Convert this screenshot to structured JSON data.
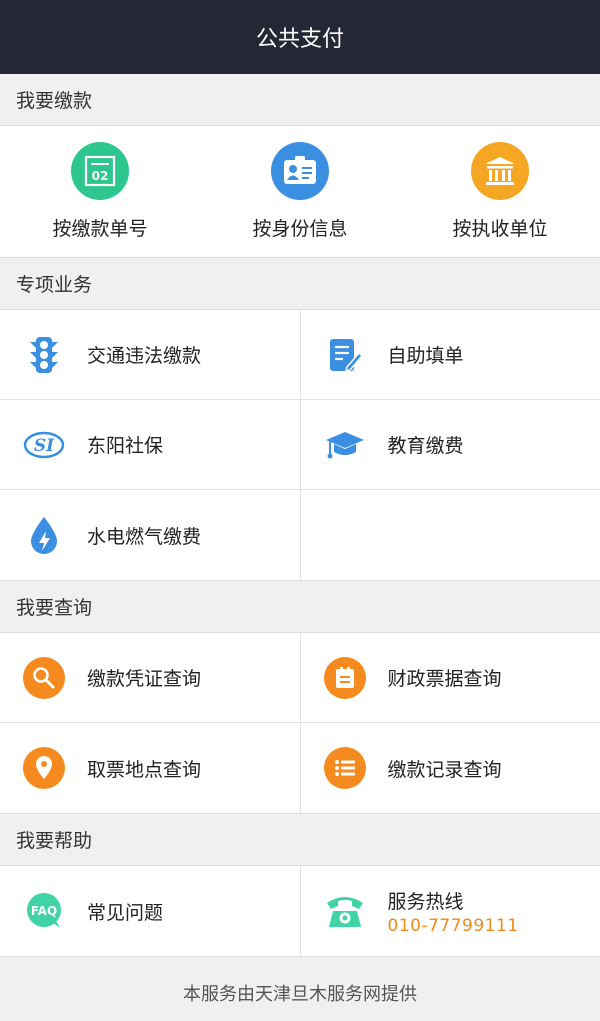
{
  "header": {
    "title": "公共支付"
  },
  "sections": {
    "pay": {
      "title": "我要缴款",
      "items": [
        {
          "label": "按缴款单号",
          "icon": "bill-number-icon",
          "icon_text": "02",
          "color": "#2dc68f"
        },
        {
          "label": "按身份信息",
          "icon": "id-card-icon",
          "color": "#3b8fe0"
        },
        {
          "label": "按执收单位",
          "icon": "building-icon",
          "color": "#f5a623"
        }
      ]
    },
    "special": {
      "title": "专项业务",
      "items": [
        {
          "label": "交通违法缴款",
          "icon": "traffic-light-icon"
        },
        {
          "label": "自助填单",
          "icon": "edit-form-icon"
        },
        {
          "label": "东阳社保",
          "icon": "social-security-icon",
          "icon_text": "SI"
        },
        {
          "label": "教育缴费",
          "icon": "graduation-cap-icon"
        },
        {
          "label": "水电燃气缴费",
          "icon": "utility-drop-icon"
        }
      ]
    },
    "query": {
      "title": "我要查询",
      "items": [
        {
          "label": "缴款凭证查询",
          "icon": "search-icon"
        },
        {
          "label": "财政票据查询",
          "icon": "receipt-icon"
        },
        {
          "label": "取票地点查询",
          "icon": "location-icon"
        },
        {
          "label": "缴款记录查询",
          "icon": "list-icon"
        }
      ]
    },
    "help": {
      "title": "我要帮助",
      "items": [
        {
          "label": "常见问题",
          "icon": "faq-icon",
          "icon_text": "FAQ"
        },
        {
          "label": "服务热线",
          "sub": "010-77799111",
          "icon": "telephone-icon"
        }
      ]
    }
  },
  "footer": {
    "text": "本服务由天津旦木服务网提供"
  },
  "colors": {
    "topbar": "#242834",
    "accent_orange": "#f58a1f",
    "icon_blue": "#3b8fe0",
    "faq_green": "#3fd3a6"
  }
}
